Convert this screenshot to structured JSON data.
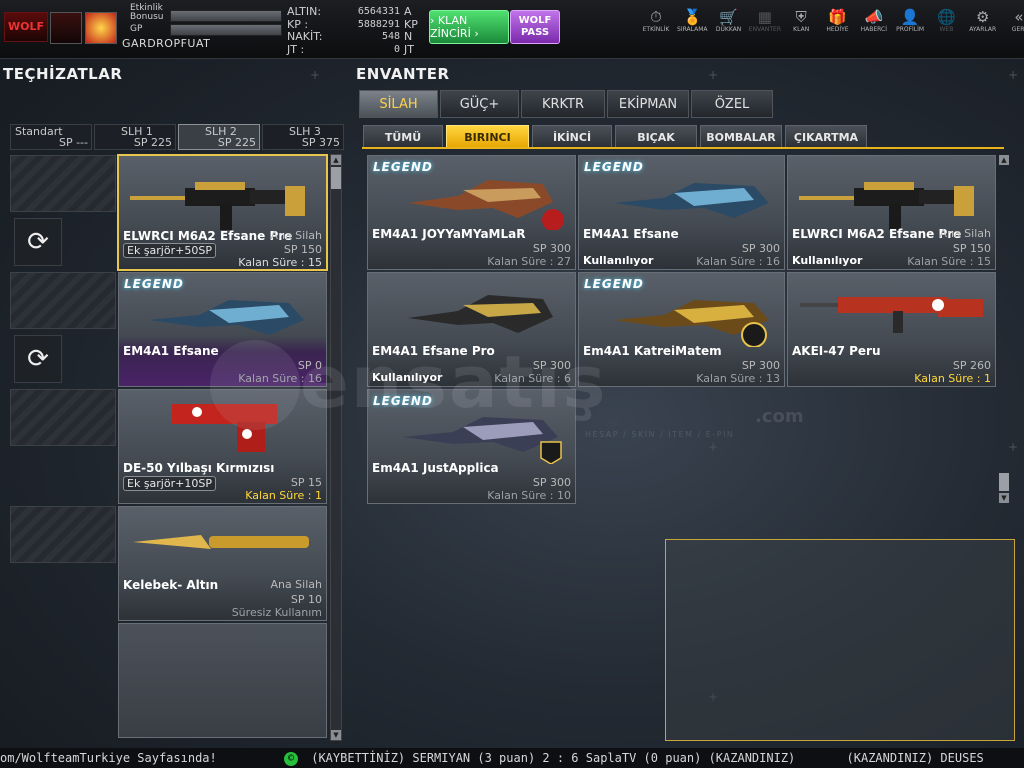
{
  "player": {
    "bonus_label": "Etkinlik\nBonusu",
    "gp_label": "GP",
    "name": "GARDROPFUAT",
    "logo_text": "WOLF"
  },
  "stats": [
    {
      "key": "ALTIN:",
      "value": "6564331",
      "unit": "A"
    },
    {
      "key": "KP  :",
      "value": "5888291",
      "unit": "KP"
    },
    {
      "key": "NAKİT:",
      "value": "548",
      "unit": "N"
    },
    {
      "key": "JT  :",
      "value": "0",
      "unit": "JT"
    }
  ],
  "klan_button": "› KLAN ZİNCİRİ ›",
  "wolf_pass": "WOLF PASS",
  "nav": [
    {
      "label": "ETKİNLİK",
      "icon": "⏱"
    },
    {
      "label": "SIRALAMA",
      "icon": "🏅"
    },
    {
      "label": "DÜKKAN",
      "icon": "🛒"
    },
    {
      "label": "ENVANTER",
      "icon": "▦"
    },
    {
      "label": "KLAN",
      "icon": "⛨"
    },
    {
      "label": "HEDİYE",
      "icon": "🎁"
    },
    {
      "label": "HABERCİ",
      "icon": "📣"
    },
    {
      "label": "PROFİLİM",
      "icon": "👤"
    },
    {
      "label": "WEB",
      "icon": "🌐"
    },
    {
      "label": "AYARLAR",
      "icon": "⚙"
    },
    {
      "label": "GERİ",
      "icon": "«"
    }
  ],
  "left_title": "TEÇHİZATLAR",
  "right_title": "ENVANTER",
  "slots": [
    {
      "label": "Standart",
      "sp": "SP ---"
    },
    {
      "label": "SLH 1",
      "sp": "SP 225"
    },
    {
      "label": "SLH 2",
      "sp": "SP 225"
    },
    {
      "label": "SLH 3",
      "sp": "SP 375"
    }
  ],
  "main_tabs": [
    "SİLAH",
    "GÜÇ+",
    "KRKTR",
    "EKİPMAN",
    "ÖZEL"
  ],
  "sub_tabs": [
    "TÜMÜ",
    "BIRINCI",
    "İKİNCİ",
    "BIÇAK",
    "BOMBALAR",
    "ÇIKARTMA"
  ],
  "equipped": [
    {
      "name": "ELWRCI M6A2 Efsane Pre",
      "type": "Ana Silah",
      "ek": "Ek şarjör+50SP",
      "sp": "SP 150",
      "kalan": "Kalan Süre : 15"
    },
    {
      "name": "EM4A1 Efsane",
      "sp": "SP 0",
      "kalan": "Kalan Süre : 16",
      "legend": "LEGEND"
    },
    {
      "name": "DE-50 Yılbaşı Kırmızısı",
      "ek": "Ek şarjör+10SP",
      "sp": "SP 15",
      "kalan": "Kalan Süre : 1"
    },
    {
      "name": "Kelebek- Altın",
      "type": "Ana Silah",
      "sp": "SP 10",
      "kalan": "Süresiz Kullanım"
    }
  ],
  "inventory": [
    {
      "name": "EM4A1 JOYYaMYaMLaR",
      "sp": "SP 300",
      "kalan": "Kalan Süre : 27",
      "legend": "LEGEND",
      "use": ""
    },
    {
      "name": "EM4A1 Efsane",
      "sp": "SP 300",
      "kalan": "Kalan Süre : 16",
      "legend": "LEGEND",
      "use": "Kullanılıyor"
    },
    {
      "name": "ELWRCI M6A2 Efsane Pre",
      "type": "Ana Silah",
      "sp": "SP 150",
      "kalan": "Kalan Süre : 15",
      "use": "Kullanılıyor"
    },
    {
      "name": "EM4A1 Efsane Pro",
      "sp": "SP 300",
      "kalan": "Kalan Süre : 6",
      "use": "Kullanılıyor"
    },
    {
      "name": "Em4A1 KatreiMatem",
      "sp": "SP 300",
      "kalan": "Kalan Süre : 13",
      "legend": "LEGEND",
      "use": ""
    },
    {
      "name": "AKEI-47 Peru",
      "sp": "SP 260",
      "kalan": "Kalan Süre : 1",
      "use": ""
    },
    {
      "name": "Em4A1 JustApplica",
      "sp": "SP 300",
      "kalan": "Kalan Süre : 10",
      "legend": "LEGEND",
      "use": ""
    }
  ],
  "watermark": {
    "main": "ensatış",
    "sub": "HESAP / SKIN / ITEM / E-PIN",
    "tld": ".com"
  },
  "ticker": "om/WolfteamTurkiye Sayfasında!",
  "ticker2": "(KAYBETTİNİZ) SERMIYAN (3 puan) 2 : 6 SaplaTV (0 puan) (KAZANDINIZ)",
  "ticker3": "(KAZANDINIZ) DEUSES"
}
